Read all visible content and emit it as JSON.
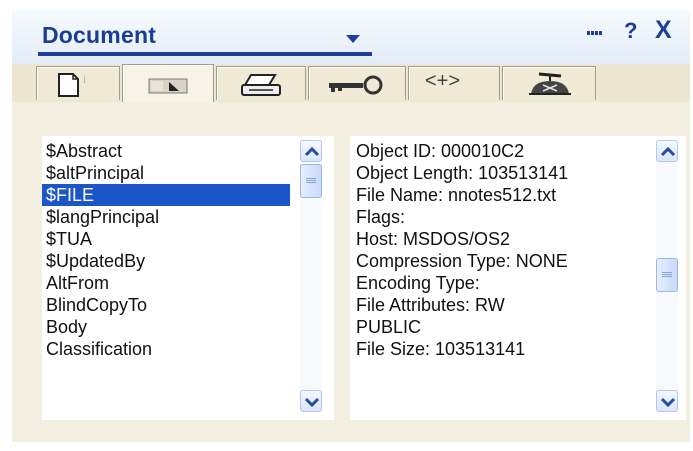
{
  "window": {
    "title": "Document",
    "help_label": "?",
    "close_label": "X"
  },
  "tabs": [
    {
      "name": "document-info",
      "icon": "page-info-icon"
    },
    {
      "name": "fields",
      "icon": "field-tag-icon"
    },
    {
      "name": "print",
      "icon": "printer-icon"
    },
    {
      "name": "security",
      "icon": "key-icon"
    },
    {
      "name": "html",
      "icon": "html-tag-icon",
      "label": "<+>"
    },
    {
      "name": "advanced",
      "icon": "propeller-hat-icon"
    }
  ],
  "active_tab": 1,
  "field_list": {
    "items": [
      "$Abstract",
      "$altPrincipal",
      "$FILE",
      "$langPrincipal",
      "$TUA",
      "$UpdatedBy",
      "AltFrom",
      "BlindCopyTo",
      "Body",
      "Classification"
    ],
    "selected": "$FILE"
  },
  "field_info": {
    "lines": [
      "Object ID: 000010C2",
      "Object Length: 103513141",
      "File Name: nnotes512.txt",
      "Flags:",
      "Host: MSDOS/OS2",
      "Compression Type: NONE",
      "Encoding Type:",
      "File Attributes: RW",
      "PUBLIC",
      "File Size: 103513141"
    ]
  },
  "colors": {
    "title_text": "#1a3d92",
    "selection": "#1b56c8",
    "panel_bg": "#f3efe0"
  }
}
